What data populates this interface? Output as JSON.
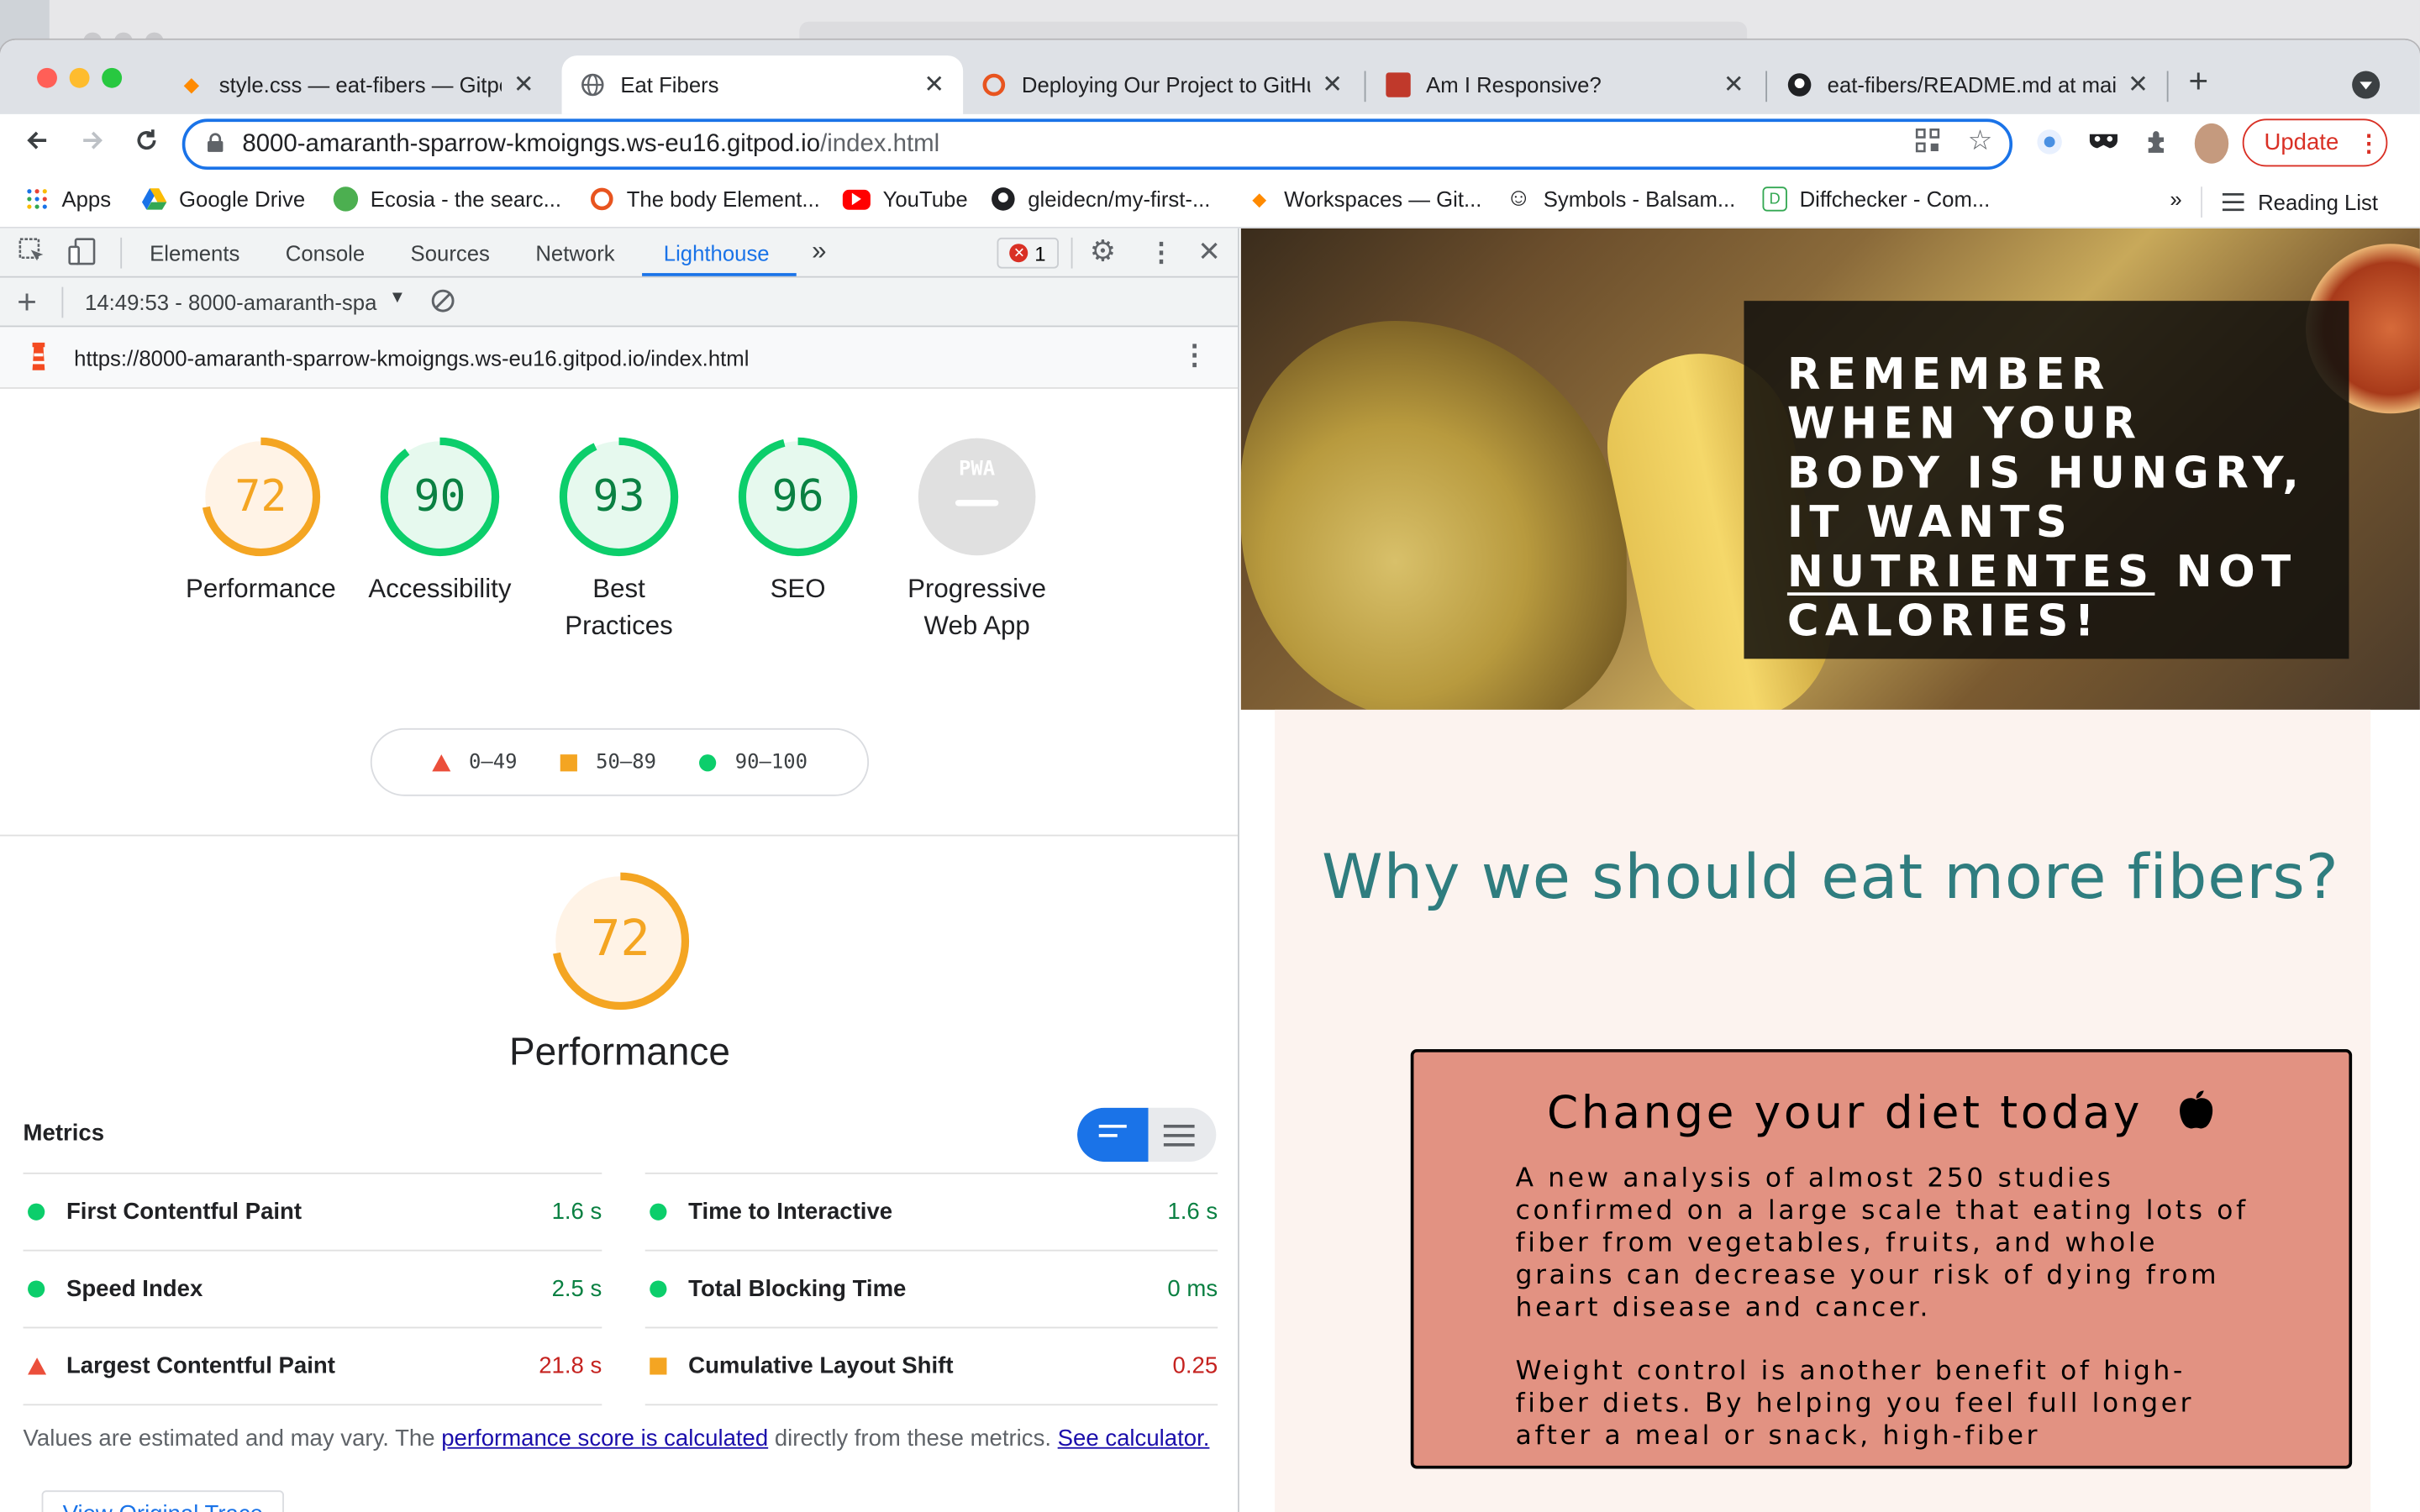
{
  "browser": {
    "tabs": [
      {
        "label": "style.css — eat-fibers — Gitpod",
        "icon": "gitpod-icon",
        "close": "✕"
      },
      {
        "label": "Eat Fibers",
        "icon": "globe-icon",
        "close": "✕"
      },
      {
        "label": "Deploying Our Project to GitHub",
        "icon": "circle-icon",
        "close": "✕"
      },
      {
        "label": "Am I Responsive?",
        "icon": "amiresponsive-icon",
        "close": "✕"
      },
      {
        "label": "eat-fibers/README.md at main",
        "icon": "github-icon",
        "close": "✕"
      }
    ],
    "new_tab": "+",
    "url_host": "8000-amaranth-sparrow-kmoigngs.ws-eu16.gitpod.io",
    "url_path": "/index.html",
    "update_label": "Update",
    "bookmarks": [
      {
        "label": "Apps"
      },
      {
        "label": "Google Drive"
      },
      {
        "label": "Ecosia - the searc..."
      },
      {
        "label": "The body Element..."
      },
      {
        "label": "YouTube"
      },
      {
        "label": "gleidecn/my-first-..."
      },
      {
        "label": "Workspaces — Git..."
      },
      {
        "label": "Symbols - Balsam..."
      },
      {
        "label": "Diffchecker - Com..."
      }
    ],
    "more_bookmarks": "»",
    "reading_list": "Reading List"
  },
  "devtools": {
    "tabs": [
      "Elements",
      "Console",
      "Sources",
      "Network",
      "Lighthouse"
    ],
    "more_tabs": "»",
    "error_count": "1",
    "report_label": "14:49:53 - 8000-amaranth-spa",
    "report_url": "https://8000-amaranth-sparrow-kmoigngs.ws-eu16.gitpod.io/index.html",
    "scores": [
      {
        "value": "72",
        "label": "Performance",
        "color": "#f4a522",
        "fraction": 0.72
      },
      {
        "value": "90",
        "label": "Accessibility",
        "color": "#0cce6b",
        "fraction": 0.9
      },
      {
        "value": "93",
        "label": "Best Practices",
        "color": "#0cce6b",
        "fraction": 0.93
      },
      {
        "value": "96",
        "label": "SEO",
        "color": "#0cce6b",
        "fraction": 0.96
      },
      {
        "value": "PWA",
        "label": "Progressive Web App",
        "color": "#9aa0a6",
        "fraction": 0
      }
    ],
    "legend": [
      "0–49",
      "50–89",
      "90–100"
    ],
    "performance_score": "72",
    "performance_title": "Performance",
    "metrics_title": "Metrics",
    "metrics": [
      {
        "label": "First Contentful Paint",
        "value": "1.6 s",
        "status": "good"
      },
      {
        "label": "Time to Interactive",
        "value": "1.6 s",
        "status": "good"
      },
      {
        "label": "Speed Index",
        "value": "2.5 s",
        "status": "good"
      },
      {
        "label": "Total Blocking Time",
        "value": "0 ms",
        "status": "good"
      },
      {
        "label": "Largest Contentful Paint",
        "value": "21.8 s",
        "status": "poor"
      },
      {
        "label": "Cumulative Layout Shift",
        "value": "0.25",
        "status": "average"
      }
    ],
    "note_prefix": "Values are estimated and may vary. The ",
    "note_link": "performance score is calculated",
    "note_mid": " directly from these metrics. ",
    "note_link2": "See calculator.",
    "trace_button": "View Original Trace"
  },
  "page": {
    "hero_line1": "Remember when your body is hungry, it wants ",
    "hero_emphasis": "nutrientes",
    "hero_line2": " not calories!",
    "section_title": "Why we should eat more fibers?",
    "card_title": "Change your diet today",
    "card_p1": "A new analysis of almost 250 studies confirmed on a large scale that eating lots of fiber from vegetables, fruits, and whole grains can decrease your risk of dying from heart disease and cancer.",
    "card_p2": "Weight control is another benefit of high-fiber diets. By helping you feel full longer after a meal or snack, high-fiber"
  }
}
